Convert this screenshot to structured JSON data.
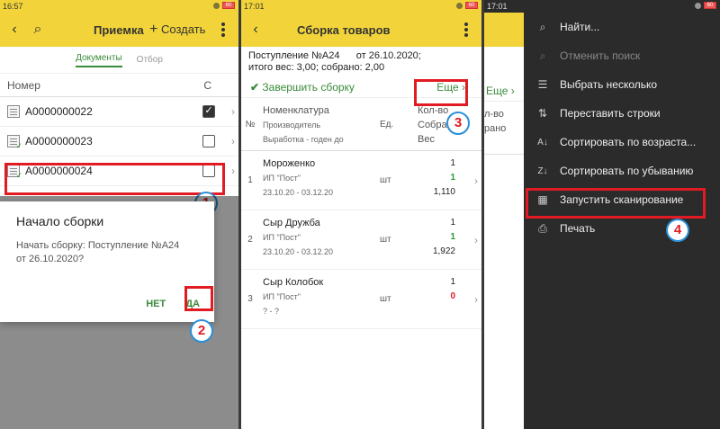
{
  "screen1": {
    "time": "16:57",
    "battery": "60",
    "title": "Приемка",
    "create_label": "Создать",
    "tabs": [
      "Документы",
      "Отбор"
    ],
    "col_number": "Номер",
    "col_check": "С",
    "rows": [
      {
        "number": "А0000000022",
        "checked": true
      },
      {
        "number": "А0000000023",
        "checked": false
      },
      {
        "number": "А0000000024",
        "checked": false
      }
    ],
    "dialog": {
      "title": "Начало сборки",
      "text_line1": "Начать сборку: Поступление №А24",
      "text_line2": "от 26.10.2020?",
      "no": "НЕТ",
      "yes": "ДА"
    },
    "markers": [
      "1",
      "2"
    ]
  },
  "screen2": {
    "time": "17:01",
    "battery": "60",
    "title": "Сборка товаров",
    "info_line1": "Поступление №А24      от 26.10.2020;",
    "info_line2": "итого вес: 3,00; собрано: 2,00",
    "finish_label": "Завершить сборку",
    "more_label": "Еще",
    "head": {
      "no": "№",
      "nomenclature": "Номенклатура",
      "producer": "Производитель",
      "production": "Выработка - годен до",
      "unit": "Ед.",
      "qty": "Кол-во",
      "collected": "Собрано",
      "weight": "Вес"
    },
    "rows": [
      {
        "no": "1",
        "name": "Мороженко",
        "producer": "ИП \"Пост\"",
        "dates": "23.10.20 - 03.12.20",
        "unit": "шт",
        "qty": "1",
        "collected": "1",
        "weight": "1,110"
      },
      {
        "no": "2",
        "name": "Сыр Дружба",
        "producer": "ИП \"Пост\"",
        "dates": "23.10.20 - 03.12.20",
        "unit": "шт",
        "qty": "1",
        "collected": "1",
        "weight": "1,922"
      },
      {
        "no": "3",
        "name": "Сыр Колобок",
        "producer": "ИП \"Пост\"",
        "dates": "? - ?",
        "unit": "шт",
        "qty": "1",
        "collected": "0",
        "weight": ""
      }
    ],
    "marker": "3"
  },
  "screen3": {
    "time": "17:01",
    "battery": "60",
    "bg_col_qty": "л-во",
    "bg_col_coll": "рано",
    "bg_more": "Еще",
    "menu": [
      {
        "icon": "search-icon",
        "label": "Найти...",
        "disabled": false
      },
      {
        "icon": "cancel-search-icon",
        "label": "Отменить поиск",
        "disabled": true
      },
      {
        "icon": "list-select-icon",
        "label": "Выбрать несколько",
        "disabled": false
      },
      {
        "icon": "reorder-icon",
        "label": "Переставить строки",
        "disabled": false
      },
      {
        "icon": "sort-asc-icon",
        "label": "Сортировать по возраста...",
        "disabled": false
      },
      {
        "icon": "sort-desc-icon",
        "label": "Сортировать по убыванию",
        "disabled": false
      },
      {
        "icon": "qr-scan-icon",
        "label": "Запустить сканирование",
        "disabled": false
      },
      {
        "icon": "print-icon",
        "label": "Печать",
        "disabled": false
      }
    ],
    "marker": "4"
  }
}
